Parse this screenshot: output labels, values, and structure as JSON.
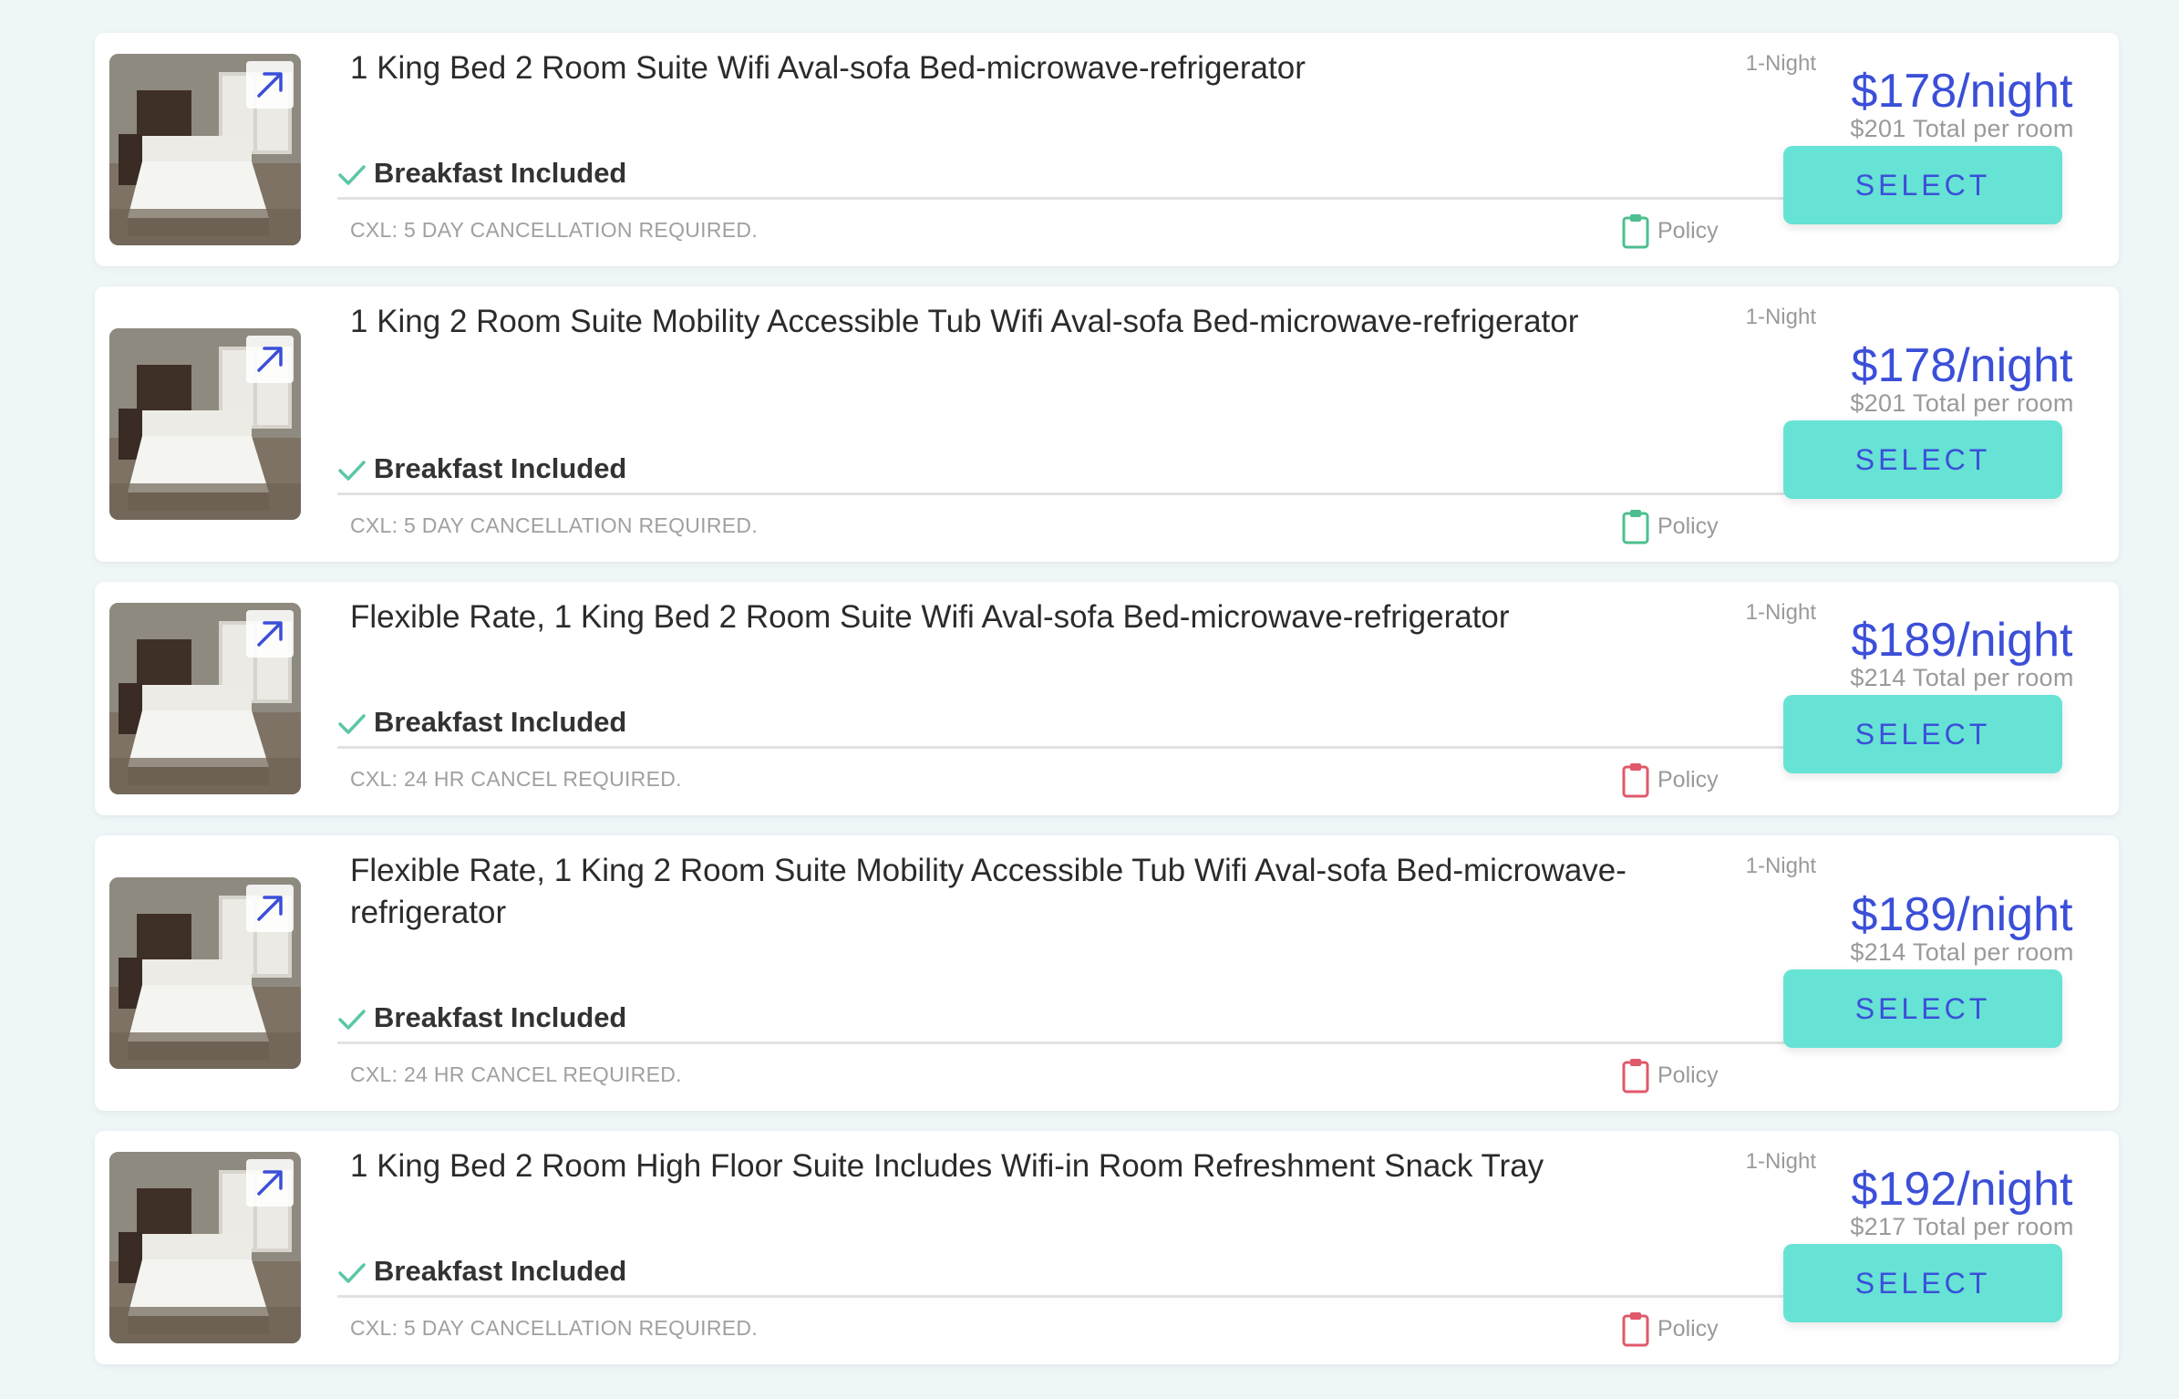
{
  "colors": {
    "page_bg": "#eef6f8",
    "accent_blue": "#3b4fd8",
    "select_button": "#66e3d4",
    "check_green": "#5cc6a8",
    "policy_green": "#4dbf8e",
    "policy_red": "#e0596b"
  },
  "rooms": [
    {
      "title": "1 King Bed 2 Room Suite Wifi Aval-sofa Bed-microwave-refrigerator",
      "nights": "1-Night",
      "breakfast": "Breakfast Included",
      "cancellation": "CXL: 5 DAY CANCELLATION REQUIRED.",
      "policy_label": "Policy",
      "policy_icon": "clipboard-green-icon",
      "price": "$178/night",
      "total": "$201 Total per room",
      "select_label": "SELECT"
    },
    {
      "title": "1 King 2 Room Suite Mobility Accessible Tub Wifi Aval-sofa Bed-microwave-refrigerator",
      "nights": "1-Night",
      "breakfast": "Breakfast Included",
      "cancellation": "CXL: 5 DAY CANCELLATION REQUIRED.",
      "policy_label": "Policy",
      "policy_icon": "clipboard-green-icon",
      "price": "$178/night",
      "total": "$201 Total per room",
      "select_label": "SELECT"
    },
    {
      "title": "Flexible Rate, 1 King Bed 2 Room Suite Wifi Aval-sofa Bed-microwave-refrigerator",
      "nights": "1-Night",
      "breakfast": "Breakfast Included",
      "cancellation": "CXL: 24 HR CANCEL REQUIRED.",
      "policy_label": "Policy",
      "policy_icon": "clipboard-red-icon",
      "price": "$189/night",
      "total": "$214 Total per room",
      "select_label": "SELECT"
    },
    {
      "title": "Flexible Rate, 1 King 2 Room Suite Mobility Accessible Tub Wifi Aval-sofa Bed-microwave-refrigerator",
      "nights": "1-Night",
      "breakfast": "Breakfast Included",
      "cancellation": "CXL: 24 HR CANCEL REQUIRED.",
      "policy_label": "Policy",
      "policy_icon": "clipboard-red-icon",
      "price": "$189/night",
      "total": "$214 Total per room",
      "select_label": "SELECT"
    },
    {
      "title": "1 King Bed 2 Room High Floor Suite Includes Wifi-in Room Refreshment Snack Tray",
      "nights": "1-Night",
      "breakfast": "Breakfast Included",
      "cancellation": "CXL: 5 DAY CANCELLATION REQUIRED.",
      "policy_label": "Policy",
      "policy_icon": "clipboard-red-icon",
      "price": "$192/night",
      "total": "$217 Total per room",
      "select_label": "SELECT"
    }
  ]
}
